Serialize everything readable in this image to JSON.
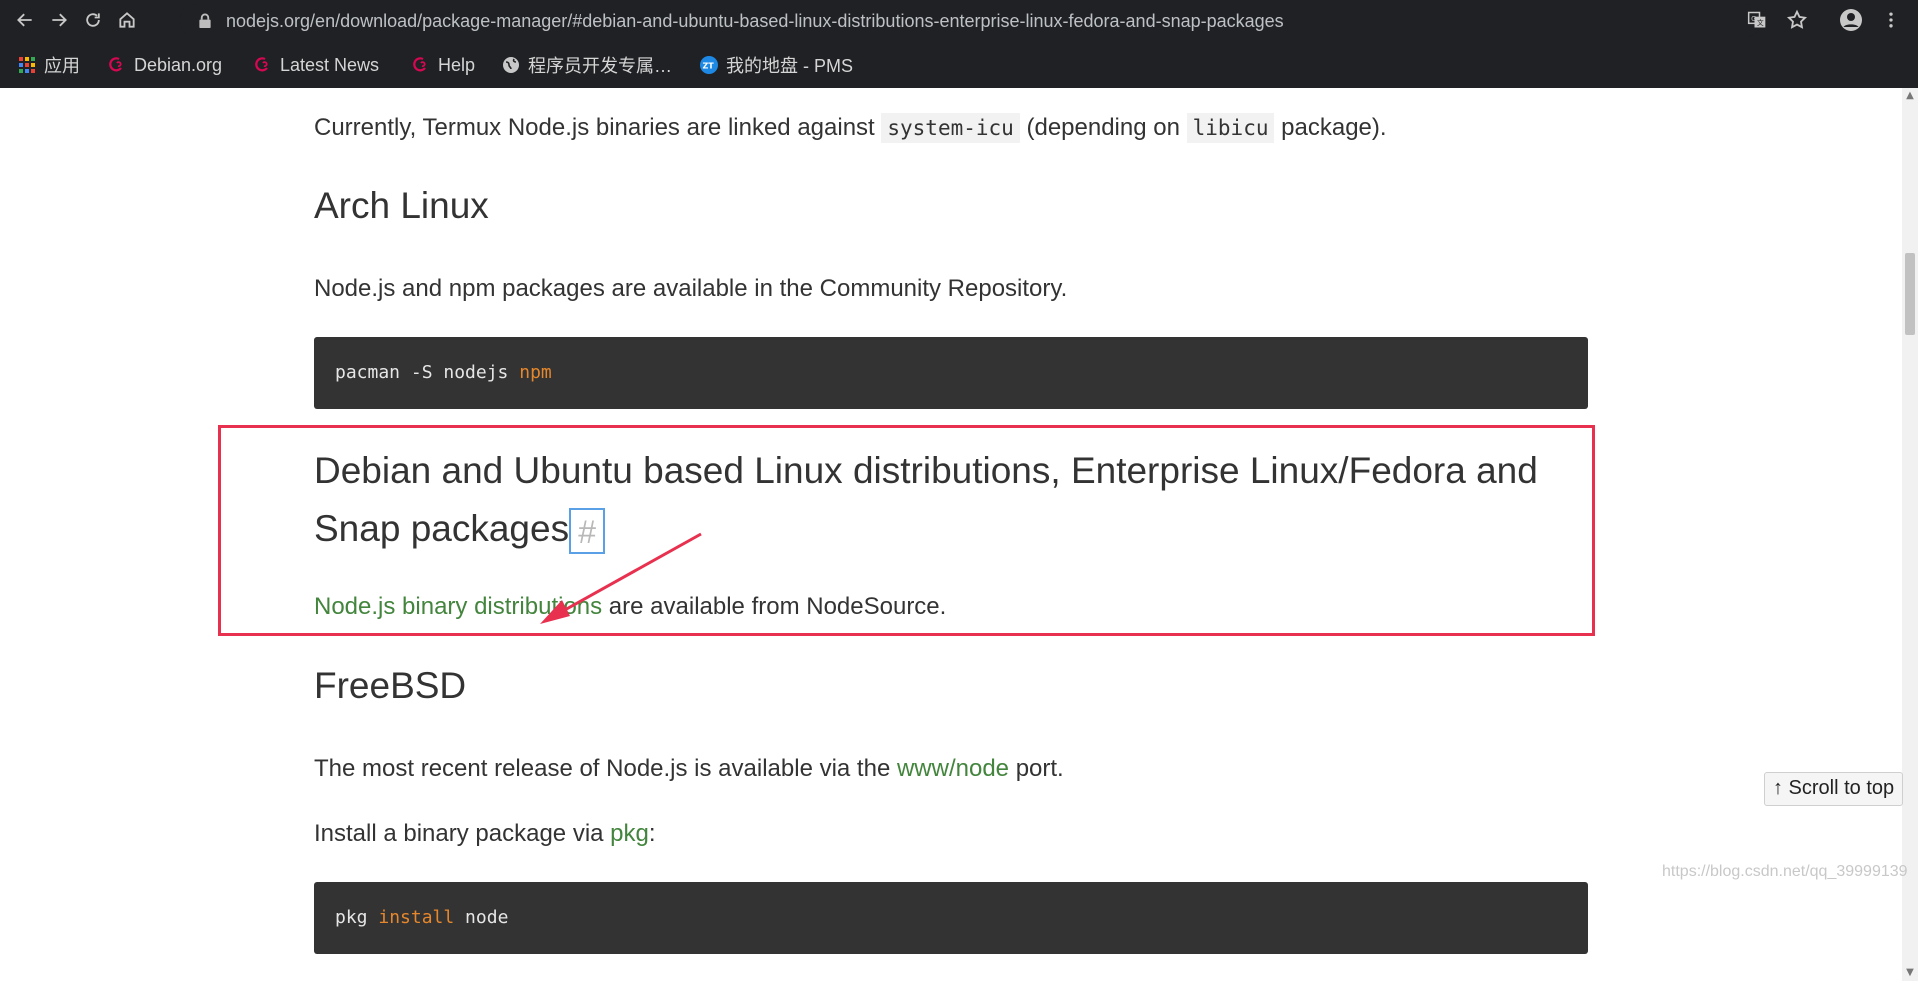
{
  "browser": {
    "url": "nodejs.org/en/download/package-manager/#debian-and-ubuntu-based-linux-distributions-enterprise-linux-fedora-and-snap-packages",
    "bookmarks": [
      {
        "label": "应用",
        "icon": "apps-grid-icon"
      },
      {
        "label": "Debian.org",
        "icon": "debian-swirl-icon"
      },
      {
        "label": "Latest News",
        "icon": "debian-swirl-icon"
      },
      {
        "label": "Help",
        "icon": "debian-swirl-icon"
      },
      {
        "label": "程序员开发专属…",
        "icon": "globe-icon"
      },
      {
        "label": "我的地盘 - PMS",
        "icon": "zt-logo-icon"
      }
    ]
  },
  "content": {
    "termux_para": {
      "before": "Currently, Termux Node.js binaries are linked against ",
      "code1": "system-icu",
      "middle": " (depending on ",
      "code2": "libicu",
      "after": " package)."
    },
    "arch": {
      "heading": "Arch Linux",
      "para": "Node.js and npm packages are available in the Community Repository.",
      "code_plain": "pacman -S nodejs ",
      "code_kw": "npm"
    },
    "debian": {
      "heading_line1": "Debian and Ubuntu based Linux distributions, Enterprise Linux/Fedora and",
      "heading_line2": "Snap packages",
      "anchor": "#",
      "link": "Node.js binary distributions",
      "after_link": " are available from NodeSource."
    },
    "freebsd": {
      "heading": "FreeBSD",
      "para_before": "The most recent release of Node.js is available via the ",
      "para_link": "www/node",
      "para_after": " port.",
      "install_before": "Install a binary package via ",
      "install_link": "pkg",
      "install_after": ":",
      "code_plain1": "pkg ",
      "code_kw": "install",
      "code_plain2": " node"
    }
  },
  "ui": {
    "scroll_to_top": "↑ Scroll to top",
    "watermark": "https://blog.csdn.net/qq_39999139"
  },
  "colors": {
    "chrome_bg": "#202124",
    "link_green": "#43853d",
    "code_bg": "#333333",
    "keyword_orange": "#e5872c",
    "highlight_red": "#e8304f"
  }
}
